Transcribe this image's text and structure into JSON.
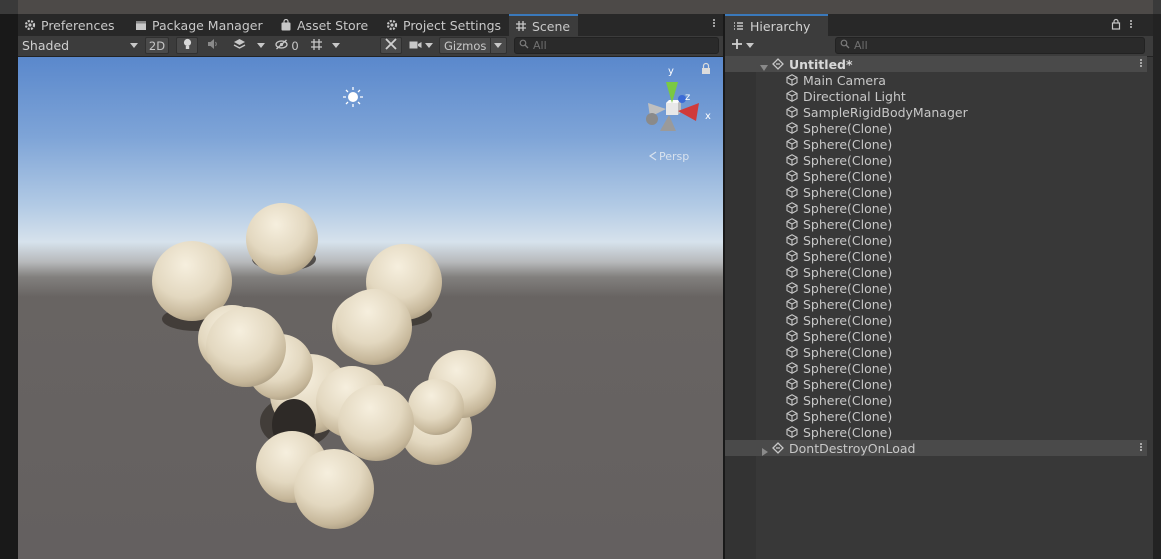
{
  "tabs": [
    {
      "label": "Preferences",
      "icon": "gear-icon"
    },
    {
      "label": "Package Manager",
      "icon": "package-icon"
    },
    {
      "label": "Asset Store",
      "icon": "shopping-bag-icon"
    },
    {
      "label": "Project Settings",
      "icon": "gear-icon"
    },
    {
      "label": "Scene",
      "icon": "grid-hash-icon",
      "active": true
    }
  ],
  "scene_toolbar": {
    "shading_mode": "Shaded",
    "mode_2d": "2D",
    "hidden_count": "0",
    "gizmos_label": "Gizmos",
    "search_placeholder": "All"
  },
  "scene_gizmo": {
    "axes": [
      "y",
      "z",
      "x"
    ],
    "colors": {
      "y": "#7ac943",
      "z": "#3c6bd6",
      "x": "#d03a3a"
    },
    "projection": "Persp"
  },
  "hierarchy": {
    "tab_label": "Hierarchy",
    "search_placeholder": "All",
    "scenes": [
      {
        "name": "Untitled*",
        "expanded": true,
        "objects": [
          "Main Camera",
          "Directional Light",
          "SampleRigidBodyManager",
          "Sphere(Clone)",
          "Sphere(Clone)",
          "Sphere(Clone)",
          "Sphere(Clone)",
          "Sphere(Clone)",
          "Sphere(Clone)",
          "Sphere(Clone)",
          "Sphere(Clone)",
          "Sphere(Clone)",
          "Sphere(Clone)",
          "Sphere(Clone)",
          "Sphere(Clone)",
          "Sphere(Clone)",
          "Sphere(Clone)",
          "Sphere(Clone)",
          "Sphere(Clone)",
          "Sphere(Clone)",
          "Sphere(Clone)",
          "Sphere(Clone)",
          "Sphere(Clone)"
        ]
      },
      {
        "name": "DontDestroyOnLoad",
        "expanded": false,
        "objects": []
      }
    ]
  },
  "colors": {
    "accent_tab": "#3a79bb",
    "sphere": "#e6dcc6"
  }
}
